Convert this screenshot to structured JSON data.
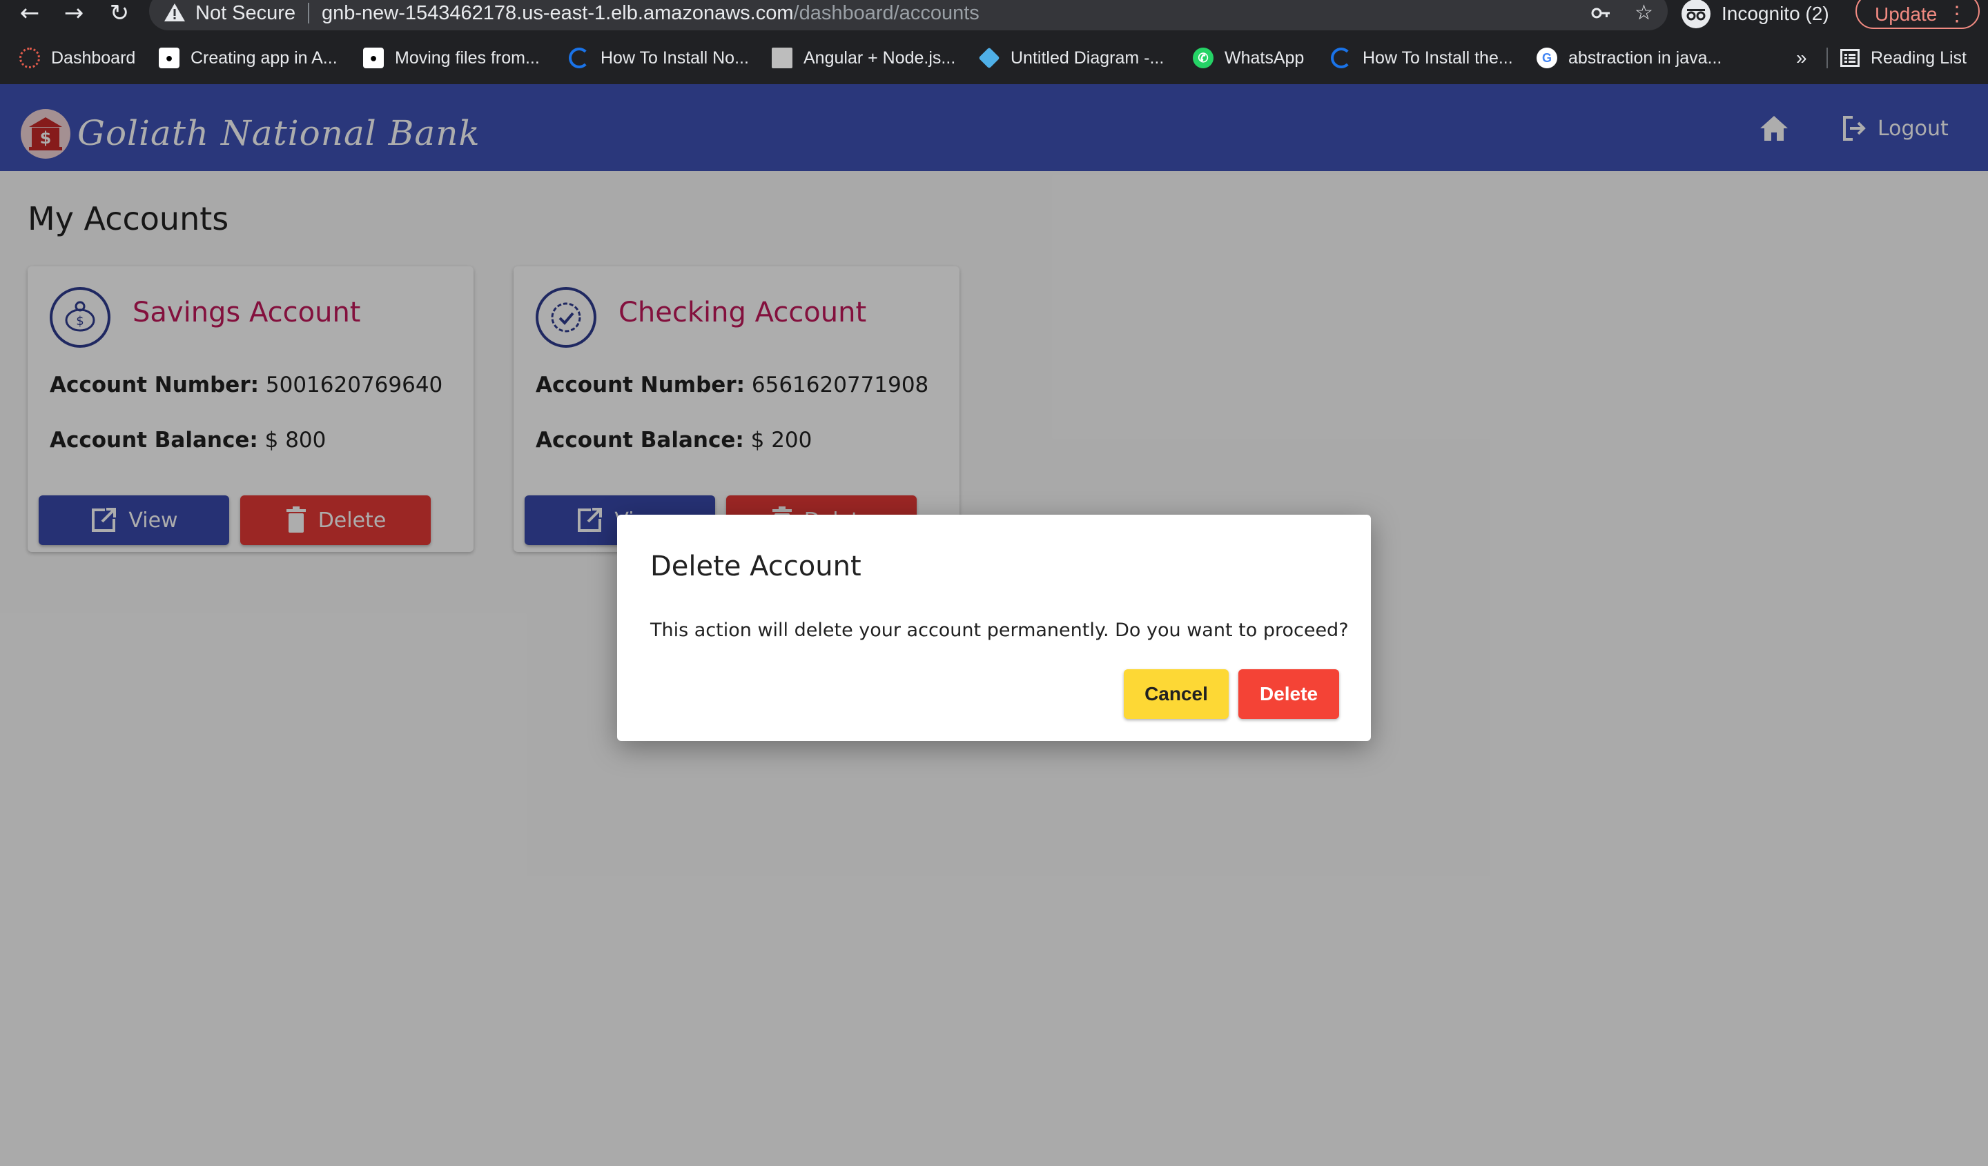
{
  "browser": {
    "security_label": "Not Secure",
    "url_host": "gnb-new-1543462178.us-east-1.elb.amazonaws.com",
    "url_path": "/dashboard/accounts",
    "profile_label": "Incognito (2)",
    "update_label": "Update",
    "bookmarks": [
      {
        "label": "Dashboard",
        "icon": "gear-red-icon"
      },
      {
        "label": "Creating app in A...",
        "icon": "medium-icon"
      },
      {
        "label": "Moving files from...",
        "icon": "medium-icon"
      },
      {
        "label": "How To Install No...",
        "icon": "digitalocean-icon"
      },
      {
        "label": "Angular + Node.js...",
        "icon": "page-thumbnail-icon"
      },
      {
        "label": "Untitled Diagram -...",
        "icon": "drawio-icon"
      },
      {
        "label": "WhatsApp",
        "icon": "whatsapp-icon"
      },
      {
        "label": "How To Install the...",
        "icon": "digitalocean-icon"
      },
      {
        "label": "abstraction in java...",
        "icon": "google-icon"
      }
    ],
    "overflow_label": "»",
    "reading_list_label": "Reading List"
  },
  "app": {
    "brand": "Goliath National Bank",
    "logout_label": "Logout",
    "colors": {
      "header": "#3f51b5",
      "title_accent": "#c2185b",
      "view": "#3949ab",
      "delete": "#e53935"
    }
  },
  "page": {
    "title": "My Accounts"
  },
  "accounts": [
    {
      "title": "Savings Account",
      "icon": "piggy-bank-icon",
      "number_label": "Account Number:",
      "number": "5001620769640",
      "balance_label": "Account Balance:",
      "balance": "$ 800",
      "view_label": "View",
      "delete_label": "Delete"
    },
    {
      "title": "Checking Account",
      "icon": "verified-badge-icon",
      "number_label": "Account Number:",
      "number": "6561620771908",
      "balance_label": "Account Balance:",
      "balance": "$ 200",
      "view_label": "View",
      "delete_label": "Delete"
    }
  ],
  "dialog": {
    "title": "Delete Account",
    "message": "This action will delete your account permanently. Do you want to proceed?",
    "cancel_label": "Cancel",
    "delete_label": "Delete",
    "colors": {
      "cancel": "#fdd835",
      "delete": "#f44336"
    }
  }
}
